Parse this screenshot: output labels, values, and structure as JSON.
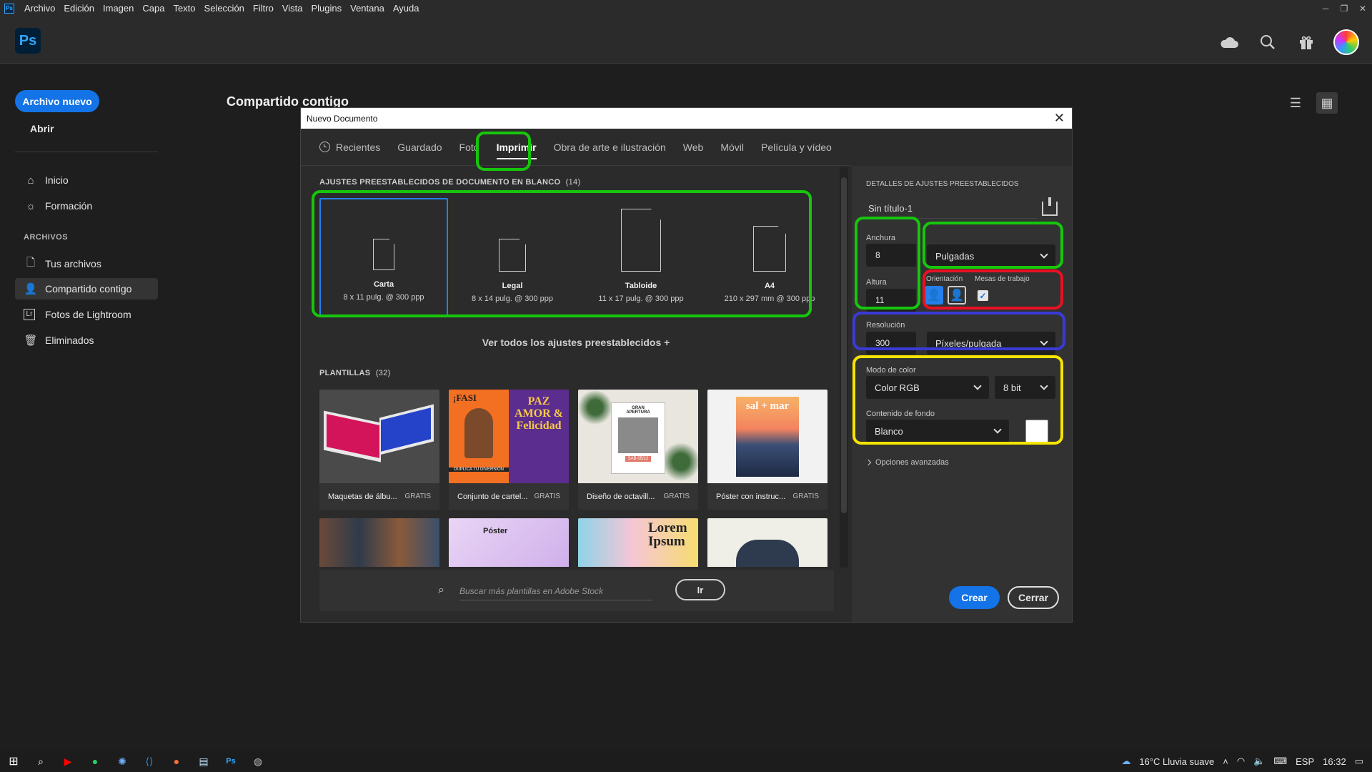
{
  "menubar": {
    "app_icon": "Ps",
    "items": [
      "Archivo",
      "Edición",
      "Imagen",
      "Capa",
      "Texto",
      "Selección",
      "Filtro",
      "Vista",
      "Plugins",
      "Ventana",
      "Ayuda"
    ],
    "window_controls": [
      "─",
      "❐",
      "✕"
    ]
  },
  "appbar": {
    "logo": "Ps",
    "icons": [
      "cloud-icon",
      "search-icon",
      "gift-icon",
      "avatar"
    ]
  },
  "sidebar": {
    "new_file": "Archivo nuevo",
    "open": "Abrir",
    "home": "Inicio",
    "learn": "Formación",
    "section_label": "ARCHIVOS",
    "your_files": "Tus archivos",
    "shared_with_you": "Compartido contigo",
    "lightroom_photos": "Fotos de Lightroom",
    "deleted": "Eliminados"
  },
  "main": {
    "title": "Compartido contigo",
    "view_icons": [
      "list-view-icon",
      "grid-view-icon"
    ]
  },
  "dialog": {
    "title": "Nuevo Documento",
    "close": "✕",
    "tabs": [
      "Recientes",
      "Guardado",
      "Foto",
      "Imprimir",
      "Obra de arte e ilustración",
      "Web",
      "Móvil",
      "Película y vídeo"
    ],
    "active_tab": "Imprimir",
    "presets_heading": "AJUSTES PREESTABLECIDOS DE DOCUMENTO EN BLANCO",
    "presets_count": "(14)",
    "presets": [
      {
        "name": "Carta",
        "desc": "8 x 11 pulg. @ 300 ppp"
      },
      {
        "name": "Legal",
        "desc": "8 x 14 pulg. @ 300 ppp"
      },
      {
        "name": "Tabloide",
        "desc": "11 x 17 pulg. @ 300 ppp"
      },
      {
        "name": "A4",
        "desc": "210 x 297 mm @ 300 ppp"
      }
    ],
    "see_all": "Ver todos los ajustes preestablecidos +",
    "templates_heading": "PLANTILLAS",
    "templates_count": "(32)",
    "templates": [
      {
        "name": "Maquetas de álbu...",
        "badge": "GRATIS"
      },
      {
        "name": "Conjunto de cartel...",
        "badge": "GRATIS"
      },
      {
        "name": "Diseño de octavill...",
        "badge": "GRATIS"
      },
      {
        "name": "Póster con instruc...",
        "badge": "GRATIS"
      }
    ],
    "template_texts": {
      "t2_a": "¡FASI",
      "t2_b": "PAZ AMOR & Felicidad",
      "t2_c": "DUPLICA TU DIVERSIÓN",
      "t3_a": "GRAN APERTURA",
      "t3_b": "SAB 05/12",
      "t4_a": "sal + mar",
      "r2_b": "Póster",
      "r2_c": "Lorem Ipsum"
    },
    "search_placeholder": "Buscar más plantillas en Adobe Stock",
    "go_button": "Ir",
    "details": {
      "heading": "DETALLES DE AJUSTES PREESTABLECIDOS",
      "doc_name": "Sin título-1",
      "width_label": "Anchura",
      "width_value": "8",
      "units": "Pulgadas",
      "height_label": "Altura",
      "height_value": "11",
      "orientation_label": "Orientación",
      "artboards_label": "Mesas de trabajo",
      "artboards_checked": true,
      "resolution_label": "Resolución",
      "resolution_value": "300",
      "resolution_units": "Píxeles/pulgada",
      "color_mode_label": "Modo de color",
      "color_mode": "Color RGB",
      "bit_depth": "8 bit",
      "background_label": "Contenido de fondo",
      "background": "Blanco",
      "advanced": "Opciones avanzadas",
      "create": "Crear",
      "close": "Cerrar"
    }
  },
  "annotations": {
    "colors": {
      "green": "#16c60c",
      "red": "#e81123",
      "blue": "#3a3ad6",
      "yellow": "#f5e400"
    }
  },
  "taskbar": {
    "weather": "16°C  Lluvia suave",
    "lang": "ESP",
    "time": "16:32"
  }
}
